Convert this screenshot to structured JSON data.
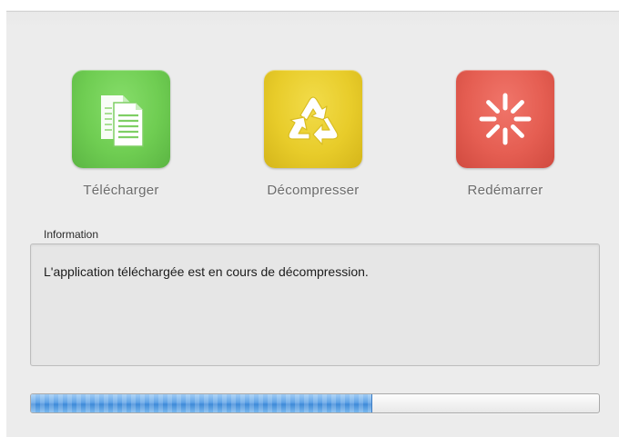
{
  "steps": [
    {
      "label": "Télécharger",
      "icon": "document-copy-icon",
      "color": "#6fcd52"
    },
    {
      "label": "Décompresser",
      "icon": "recycle-icon",
      "color": "#e8cc2a"
    },
    {
      "label": "Redémarrer",
      "icon": "spinner-icon",
      "color": "#e55e52"
    }
  ],
  "info": {
    "legend": "Information",
    "message": "L'application téléchargée est en cours de décompression."
  },
  "progress": {
    "fraction": 0.6,
    "color": "#4a90dc"
  }
}
